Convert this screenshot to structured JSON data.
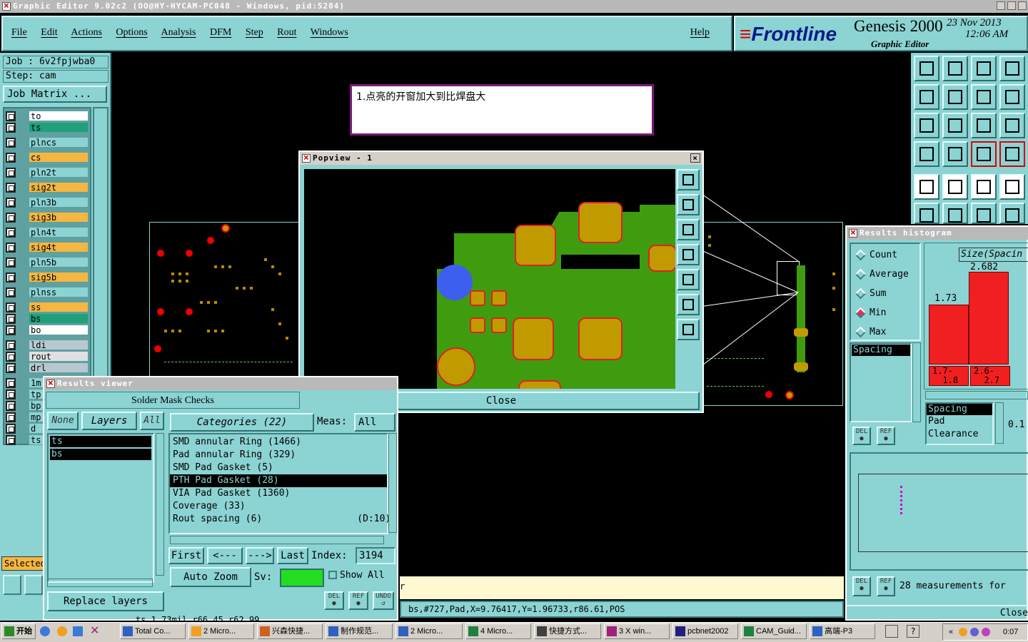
{
  "window": {
    "title": "Graphic Editor 9.02c2 (OO@HY-HYCAM-PC048 - Windows, pid:5204)"
  },
  "menu": {
    "items": [
      "File",
      "Edit",
      "Actions",
      "Options",
      "Analysis",
      "DFM",
      "Step",
      "Rout",
      "Windows"
    ],
    "help": "Help"
  },
  "brand": {
    "logo": "Frontline",
    "product": "Genesis 2000",
    "subtitle": "Graphic Editor",
    "date": "23 Nov 2013",
    "time": "12:06 AM"
  },
  "job": {
    "job_label": "Job :",
    "job_name": "6v2fpjwba0",
    "step_label": "Step:",
    "step_name": "cam",
    "matrix_btn": "Job Matrix ..."
  },
  "layers": [
    {
      "name": "to",
      "color": "#ffffff"
    },
    {
      "name": "ts",
      "color": "#1fa07a"
    },
    {
      "name": "plncs",
      "color": "#8cd3d3"
    },
    {
      "name": "cs",
      "color": "#f5b642"
    },
    {
      "name": "pln2t",
      "color": "#8cd3d3"
    },
    {
      "name": "sig2t",
      "color": "#f5b642"
    },
    {
      "name": "pln3b",
      "color": "#8cd3d3"
    },
    {
      "name": "sig3b",
      "color": "#f5b642"
    },
    {
      "name": "pln4t",
      "color": "#8cd3d3"
    },
    {
      "name": "sig4t",
      "color": "#f5b642"
    },
    {
      "name": "pln5b",
      "color": "#8cd3d3"
    },
    {
      "name": "sig5b",
      "color": "#f5b642"
    },
    {
      "name": "plnss",
      "color": "#8cd3d3"
    },
    {
      "name": "ss",
      "color": "#f5b642"
    },
    {
      "name": "bs",
      "color": "#1fa07a"
    },
    {
      "name": "bo",
      "color": "#ffffff"
    },
    {
      "name": "ldi",
      "color": "#b8c8d0"
    },
    {
      "name": "rout",
      "color": "#e0e0e0"
    },
    {
      "name": "drl",
      "color": "#b8c8d0"
    },
    {
      "name": "1m",
      "color": "#8cd3d3"
    },
    {
      "name": "tp",
      "color": "#8cd3d3"
    },
    {
      "name": "bp",
      "color": "#8cd3d3"
    },
    {
      "name": "mp",
      "color": "#8cd3d3"
    },
    {
      "name": "d",
      "color": "#8cd3d3"
    },
    {
      "name": "ts",
      "color": "#8cd3d3"
    }
  ],
  "selected_label": "Selected",
  "note": {
    "text": "1.点亮的开窗加大到比焊盘大"
  },
  "popview": {
    "title": "Popview - 1",
    "close": "Close"
  },
  "results_viewer": {
    "title": "Results viewer",
    "heading": "Solder Mask Checks",
    "none_btn": "None",
    "layers_btn": "Layers",
    "all_btn": "All",
    "layer_list": [
      "ts",
      "bs"
    ],
    "categories_label": "Categories (22)",
    "meas_label": "Meas:",
    "meas_value": "All",
    "categories": [
      "SMD annular Ring (1466)",
      "Pad annular Ring (329)",
      "SMD Pad Gasket (5)",
      "PTH Pad Gasket (28)",
      "VIA Pad Gasket (1360)",
      "Coverage (33)",
      "Rout spacing (6)                 (D:10)"
    ],
    "selected_category": 3,
    "first": "First",
    "prev": "<---",
    "next": "--->",
    "last": "Last",
    "index_label": "Index:",
    "index_value": "3194",
    "auto_zoom": "Auto Zoom",
    "sv_label": "Sv:",
    "show_all": "Show All",
    "replace_layers": "Replace layers",
    "del": "DEL",
    "ref": "REF",
    "undo": "UNDO"
  },
  "status": {
    "coords": "bs,#727,Pad,X=9.76417,Y=1.96733,r86.61,POS",
    "left_line": "r",
    "bottom_partial": "ts 1.73mil  r66.45  r62.99"
  },
  "histogram": {
    "title": "Results histogram",
    "options": [
      "Count",
      "Average",
      "Sum",
      "Min",
      "Max"
    ],
    "selected_option": "Min",
    "axis_title": "Size(Spacin",
    "bars": [
      {
        "value": 1.73,
        "range": "1.7-\n  1.8"
      },
      {
        "value": 2.682,
        "range": "2.6-\n  2.7"
      }
    ],
    "list1": [
      "Spacing"
    ],
    "list2": [
      "Spacing",
      "Pad",
      "Clearance"
    ],
    "value_partial": "0.1",
    "summary": "28 measurements for",
    "close": "Close",
    "del": "DEL",
    "ref": "REF"
  },
  "taskbar": {
    "start": "开始",
    "items": [
      "Total Co...",
      "2 Micro...",
      "兴森快捷...",
      "制作规范...",
      "2 Micro...",
      "4 Micro...",
      "快捷方式...",
      "3 X win...",
      "pcbnet2002",
      "CAM_Guid...",
      "高端-P3"
    ],
    "clock": "0:07"
  }
}
